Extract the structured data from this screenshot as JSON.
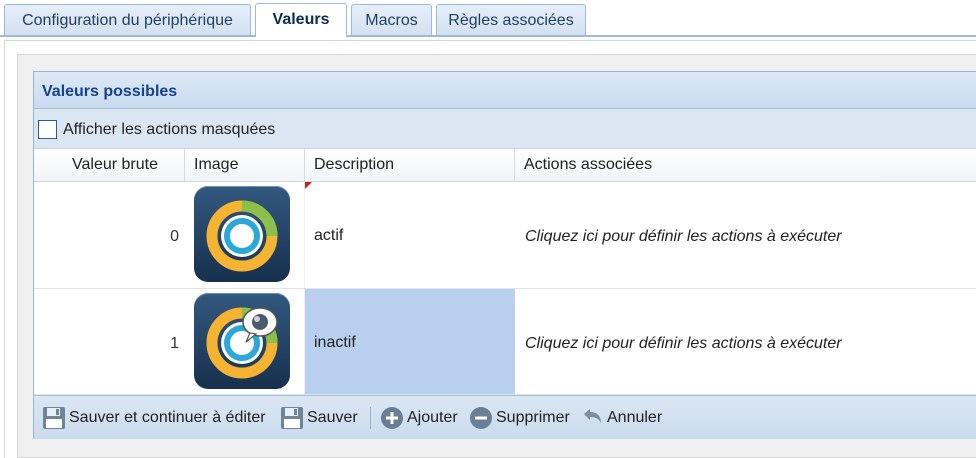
{
  "tabs": [
    {
      "label": "Configuration du périphérique",
      "active": false
    },
    {
      "label": "Valeurs",
      "active": true
    },
    {
      "label": "Macros",
      "active": false
    },
    {
      "label": "Règles associées",
      "active": false
    }
  ],
  "panel": {
    "title": "Valeurs possibles",
    "show_hidden_label": "Afficher les actions masquées",
    "show_hidden_checked": false
  },
  "grid": {
    "columns": [
      "Valeur brute",
      "Image",
      "Description",
      "Actions associées"
    ],
    "rows": [
      {
        "raw": "0",
        "image_icon": "gauge-icon",
        "description": "actif",
        "actions": "Cliquez ici pour définir les actions à exécuter"
      },
      {
        "raw": "1",
        "image_icon": "gauge-with-bubble-icon",
        "description": "inactif",
        "actions": "Cliquez ici pour définir les actions à exécuter"
      }
    ]
  },
  "toolbar": {
    "save_continue": "Sauver et continuer à éditer",
    "save": "Sauver",
    "add": "Ajouter",
    "delete": "Supprimer",
    "cancel": "Annuler"
  },
  "colors": {
    "accent": "#15428b",
    "selection": "#b8cfee",
    "dirty_marker": "#c62020"
  }
}
